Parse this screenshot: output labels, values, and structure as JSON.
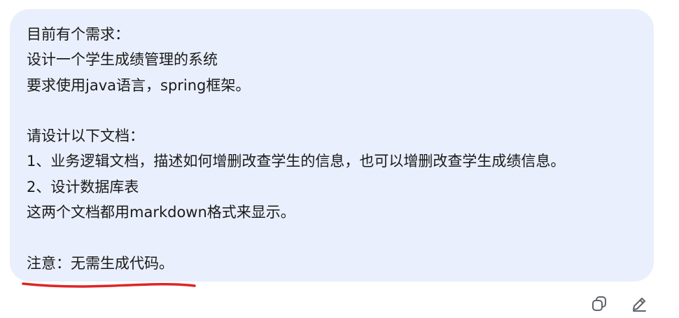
{
  "message": {
    "lines": [
      "目前有个需求：",
      "设计一个学生成绩管理的系统",
      "要求使用java语言，spring框架。",
      "",
      "请设计以下文档：",
      "1、业务逻辑文档，描述如何增删改查学生的信息，也可以增删改查学生成绩信息。",
      "2、设计数据库表",
      "这两个文档都用markdown格式来显示。",
      "",
      "注意：无需生成代码。"
    ]
  },
  "colors": {
    "bubble_background": "#e9effc",
    "text": "#1a1a1a",
    "annotation": "#e02424",
    "icon": "#5f6368"
  },
  "actions": {
    "copy_icon": "copy-icon",
    "edit_icon": "pencil-icon"
  }
}
